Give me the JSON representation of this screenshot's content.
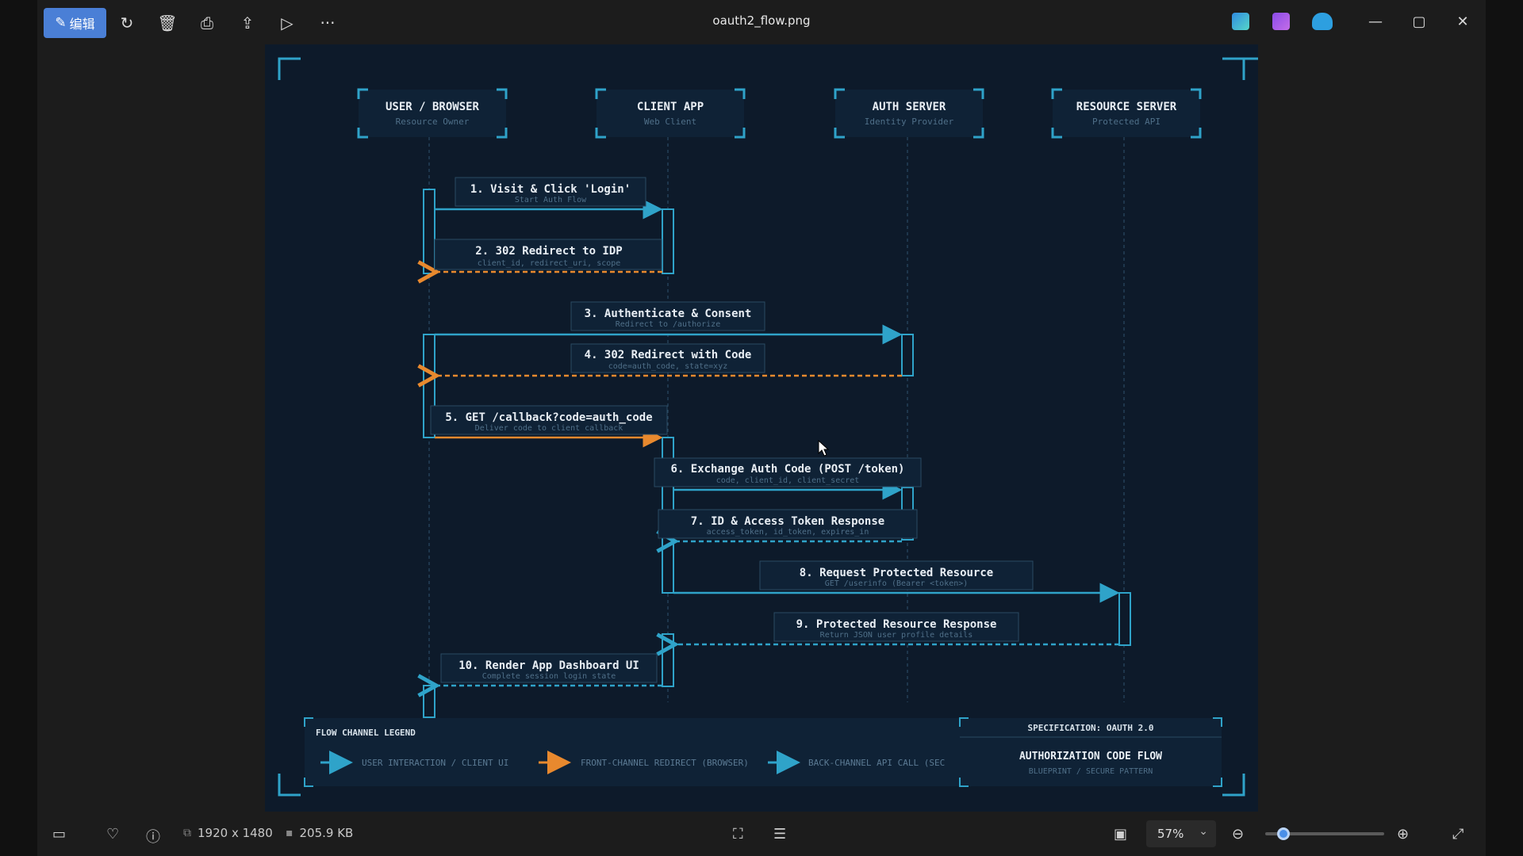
{
  "titlebar": {
    "edit_label": "编辑",
    "filename": "oauth2_flow.png",
    "icons": [
      "edit-icon",
      "rotate-icon",
      "delete-icon",
      "print-icon",
      "share-icon",
      "slideshow-icon",
      "more-icon"
    ],
    "more_label": "···"
  },
  "diagram": {
    "lanes": [
      {
        "title": "USER / BROWSER",
        "subtitle": "Resource Owner"
      },
      {
        "title": "CLIENT APP",
        "subtitle": "Web Client"
      },
      {
        "title": "AUTH SERVER",
        "subtitle": "Identity Provider"
      },
      {
        "title": "RESOURCE SERVER",
        "subtitle": "Protected API"
      }
    ],
    "steps": [
      {
        "title": "1. Visit & Click 'Login'",
        "detail": "Start Auth Flow"
      },
      {
        "title": "2. 302 Redirect to IDP",
        "detail": "client_id, redirect_uri, scope"
      },
      {
        "title": "3. Authenticate & Consent",
        "detail": "Redirect to /authorize"
      },
      {
        "title": "4. 302 Redirect with Code",
        "detail": "code=auth_code, state=xyz"
      },
      {
        "title": "5. GET /callback?code=auth_code",
        "detail": "Deliver code to client callback"
      },
      {
        "title": "6. Exchange Auth Code (POST /token)",
        "detail": "code, client_id, client_secret"
      },
      {
        "title": "7. ID & Access Token Response",
        "detail": "access_token, id_token, expires_in"
      },
      {
        "title": "8. Request Protected Resource",
        "detail": "GET /userinfo (Bearer <token>)"
      },
      {
        "title": "9. Protected Resource Response",
        "detail": "Return JSON user profile details"
      },
      {
        "title": "10. Render App Dashboard UI",
        "detail": "Complete session login state"
      }
    ],
    "legend": {
      "title": "FLOW CHANNEL LEGEND",
      "items": [
        "USER INTERACTION / CLIENT UI",
        "FRONT-CHANNEL REDIRECT (BROWSER)",
        "BACK-CHANNEL API CALL (SEC"
      ]
    },
    "spec": {
      "label": "SPECIFICATION: OAUTH 2.0",
      "title": "AUTHORIZATION CODE FLOW",
      "subtitle": "BLUEPRINT / SECURE PATTERN"
    },
    "colors": {
      "cyan": "#2fa3c9",
      "orange": "#e8892e",
      "background": "#0d1a2a",
      "box": "#0f2236"
    }
  },
  "statusbar": {
    "dimensions": "1920 x 1480",
    "filesize": "205.9 KB",
    "zoom": "57%",
    "zoom_level_fraction": 0.1
  }
}
